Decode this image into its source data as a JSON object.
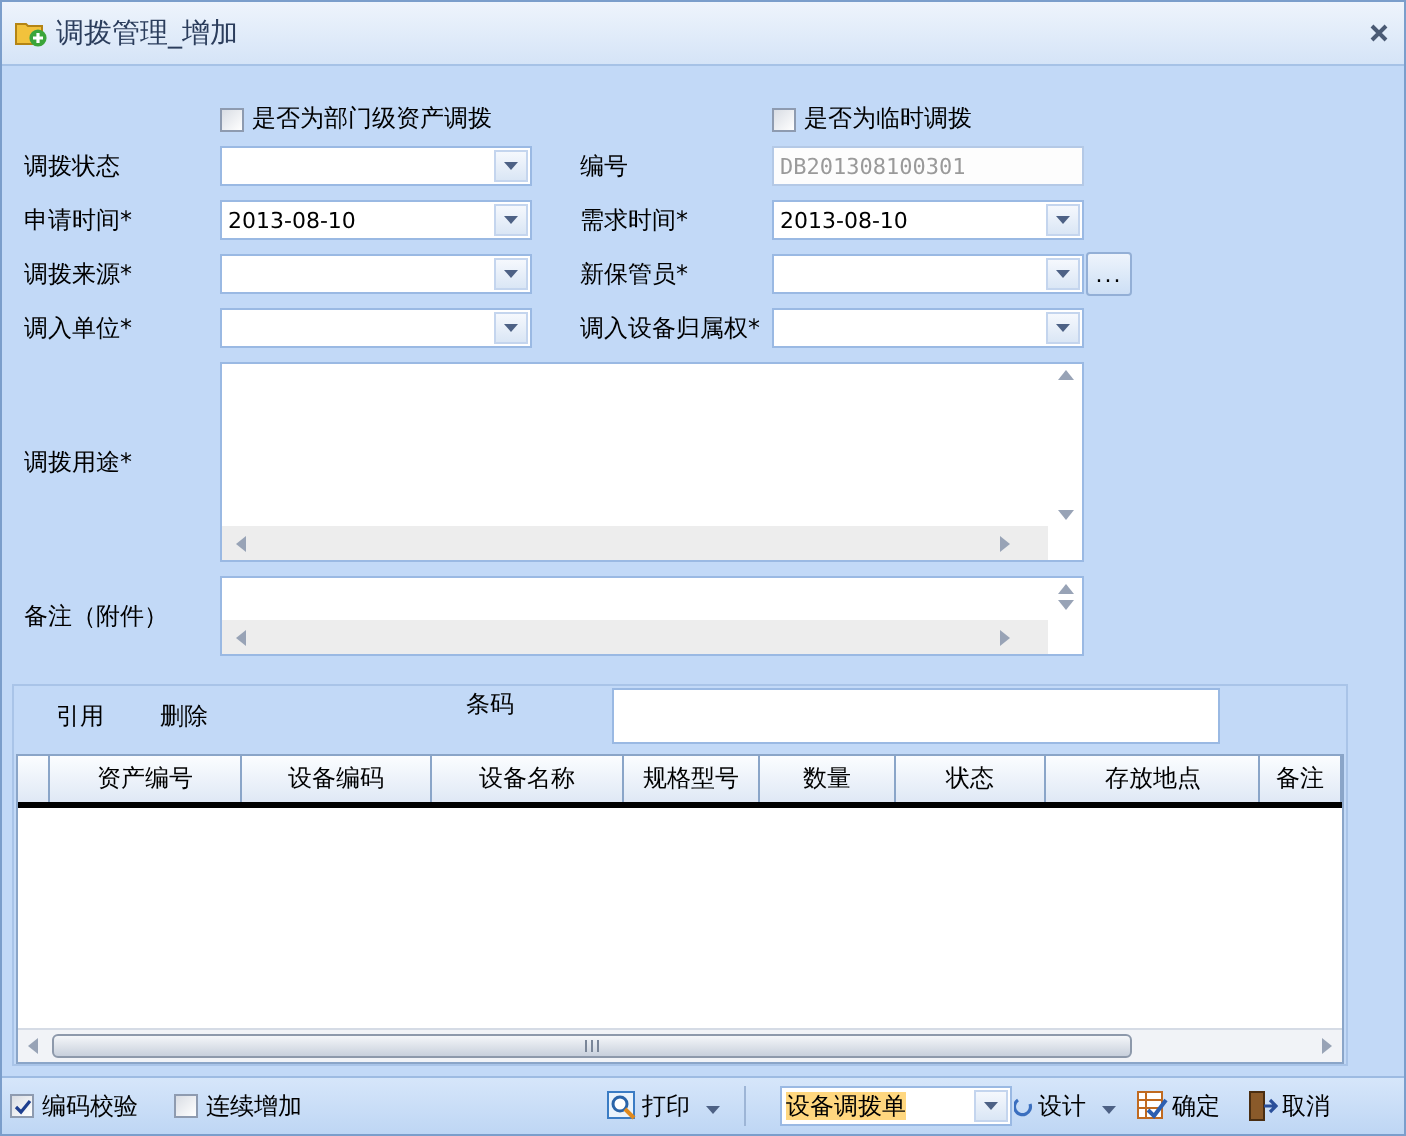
{
  "window": {
    "title": "调拨管理_增加"
  },
  "options": [
    {
      "label": "是否为部门级资产调拨",
      "checked": false
    },
    {
      "label": "是否为临时调拨",
      "checked": false
    }
  ],
  "fields": [
    {
      "label": "调拨状态",
      "kind": "combo",
      "disabled": false
    },
    {
      "label": "编号",
      "kind": "text",
      "value": "DB201308100301",
      "disabled": true
    },
    {
      "label": "申请时间*",
      "kind": "date",
      "value": "2013-08-10",
      "disabled": false
    },
    {
      "label": "需求时间*",
      "kind": "date",
      "value": "2013-08-10",
      "disabled": false
    },
    {
      "label": "调拨来源*",
      "kind": "combo",
      "disabled": false
    },
    {
      "label": "新保管员*",
      "kind": "combo",
      "browse": "...",
      "disabled": false
    },
    {
      "label": "调入单位*",
      "kind": "combo",
      "disabled": false
    },
    {
      "label": "调入设备归属权*",
      "kind": "combo",
      "disabled": false
    }
  ],
  "memos": [
    {
      "label": "调拨用途*"
    },
    {
      "label": "备注（附件）"
    }
  ],
  "detail": {
    "actions": [
      "引用",
      "删除"
    ],
    "barcode_label": "条码",
    "columns": [
      "资产编号",
      "设备编码",
      "设备名称",
      "规格型号",
      "数量",
      "状态",
      "存放地点",
      "备注"
    ]
  },
  "footer": {
    "checks": [
      {
        "label": "编码校验",
        "checked": true
      },
      {
        "label": "连续增加",
        "checked": false
      }
    ],
    "print": "打印",
    "template": "设备调拨单",
    "design": "设计",
    "ok": "确定",
    "cancel": "取消"
  }
}
